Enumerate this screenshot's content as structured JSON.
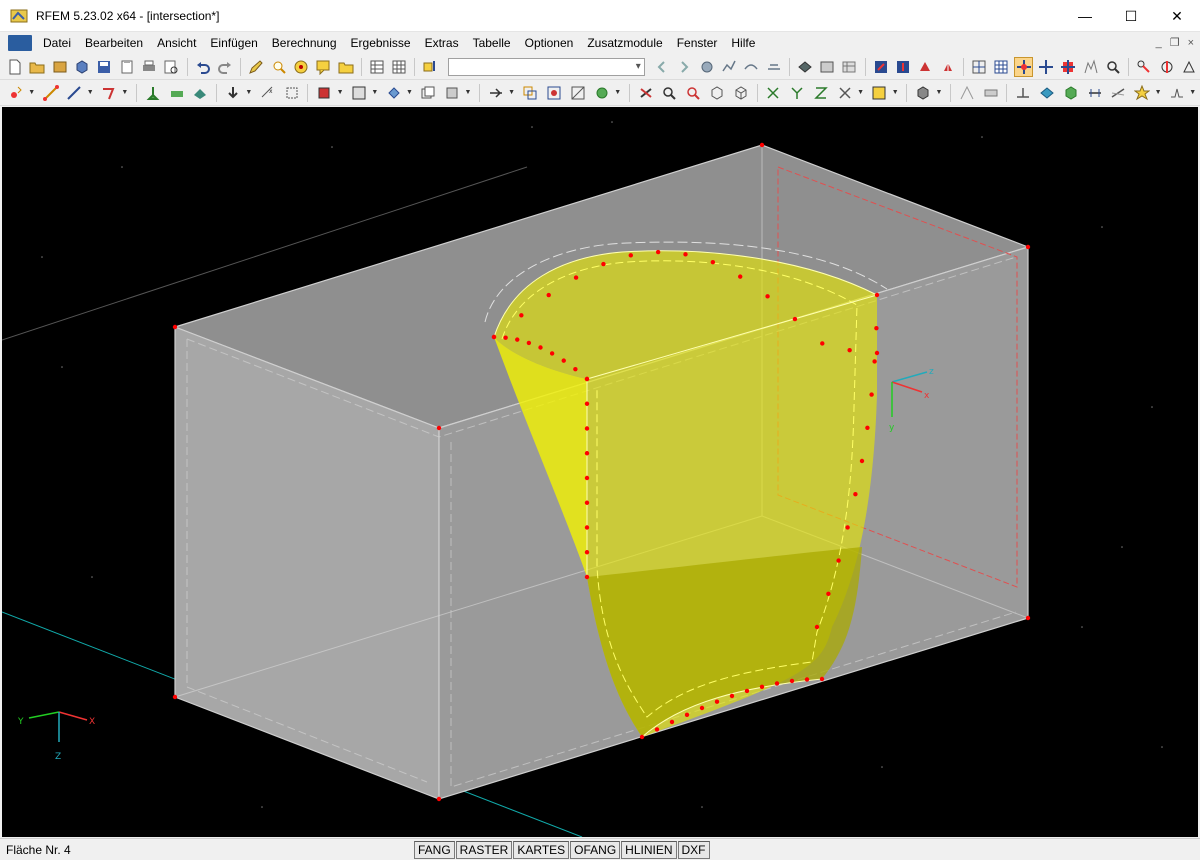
{
  "window": {
    "title": "RFEM 5.23.02 x64 - [intersection*]",
    "min_glyph": "—",
    "max_glyph": "☐",
    "close_glyph": "✕"
  },
  "menu": {
    "items": [
      "Datei",
      "Bearbeiten",
      "Ansicht",
      "Einfügen",
      "Berechnung",
      "Ergebnisse",
      "Extras",
      "Tabelle",
      "Optionen",
      "Zusatzmodule",
      "Fenster",
      "Hilfe"
    ],
    "mdi_min": "_",
    "mdi_restore": "❐",
    "mdi_close": "×"
  },
  "toolbar": {
    "combo_value": ""
  },
  "viewport": {
    "background": "#000000",
    "surface_color": "#e8e800",
    "box_color": "#9a9a9a",
    "node_color": "#ff0000",
    "global_axes": {
      "x": "X",
      "y": "Y",
      "z": "Z"
    },
    "local_axes": {
      "x": "x",
      "y": "y",
      "z": "z"
    }
  },
  "status": {
    "text": "Fläche Nr. 4",
    "buttons": [
      "FANG",
      "RASTER",
      "KARTES",
      "OFANG",
      "HLINIEN",
      "DXF"
    ]
  }
}
